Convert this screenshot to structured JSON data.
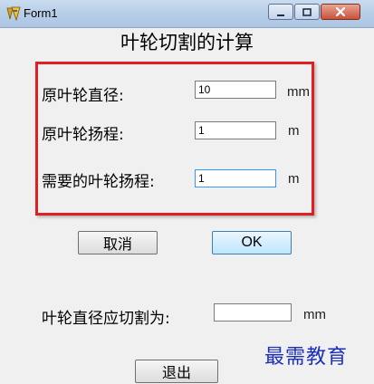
{
  "window": {
    "title": "Form1",
    "buttons": {
      "minimize": "minimize",
      "maximize": "maximize",
      "close": "close"
    }
  },
  "form": {
    "heading": "叶轮切割的计算",
    "fields": [
      {
        "label": "原叶轮直径:",
        "value": "10",
        "unit": "mm"
      },
      {
        "label": "原叶轮扬程:",
        "value": "1",
        "unit": "m"
      },
      {
        "label": "需要的叶轮扬程:",
        "value": "1",
        "unit": "m"
      }
    ],
    "cancel_label": "取消",
    "ok_label": "OK",
    "result": {
      "label": "叶轮直径应切割为:",
      "value": "",
      "unit": "mm"
    },
    "exit_label": "退出"
  },
  "overlay": {
    "watermark": "最需教育",
    "highlight_color": "#e02020"
  }
}
